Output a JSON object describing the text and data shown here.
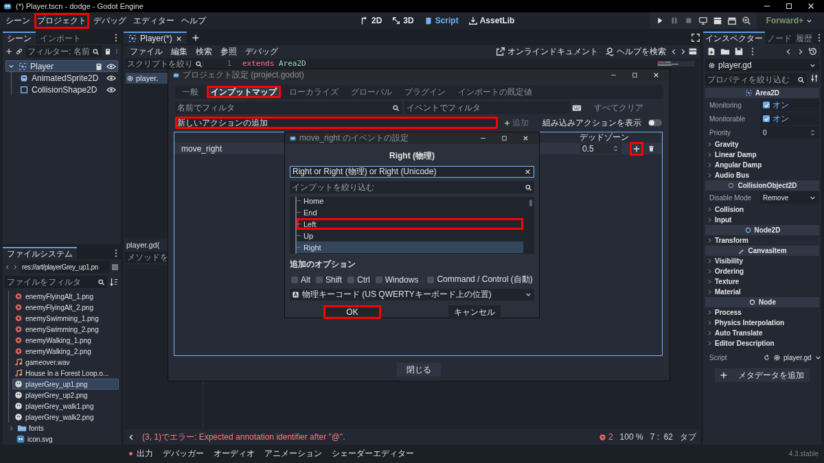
{
  "window": {
    "title": "(*) Player.tscn - dodge - Godot Engine"
  },
  "menu": [
    {
      "label": "シーン",
      "highlighted": false
    },
    {
      "label": "プロジェクト",
      "highlighted": true
    },
    {
      "label": "デバッグ",
      "highlighted": false
    },
    {
      "label": "エディター",
      "highlighted": false
    },
    {
      "label": "ヘルプ",
      "highlighted": false
    }
  ],
  "workspaces": [
    {
      "label": "2D",
      "selected": false
    },
    {
      "label": "3D",
      "selected": false
    },
    {
      "label": "Script",
      "selected": true
    },
    {
      "label": "AssetLib",
      "selected": false
    }
  ],
  "renderer": "Forward+",
  "scene_dock": {
    "tabs": [
      {
        "label": "シーン",
        "selected": true
      },
      {
        "label": "インポート",
        "selected": false
      }
    ],
    "filter": {
      "placeholder": "フィルター: 名前"
    },
    "tree": [
      {
        "name": "Player",
        "kind": "area",
        "selected": true,
        "expanded": true,
        "children": [
          {
            "name": "AnimatedSprite2D",
            "kind": "sprite",
            "selected": false
          },
          {
            "name": "CollisionShape2D",
            "kind": "shape",
            "selected": false
          }
        ]
      }
    ]
  },
  "filesystem": {
    "tab": "ファイルシステム",
    "path": "res://art/playerGrey_up1.pn",
    "filter": {
      "placeholder": "ファイルをフィルタ"
    },
    "folder_contents": [
      {
        "name": "enemyFlyingAlt_1.png",
        "kind": "image",
        "selected": false
      },
      {
        "name": "enemyFlyingAlt_2.png",
        "kind": "image",
        "selected": false
      },
      {
        "name": "enemySwimming_1.png",
        "kind": "image",
        "selected": false
      },
      {
        "name": "enemySwimming_2.png",
        "kind": "image",
        "selected": false
      },
      {
        "name": "enemyWalking_1.png",
        "kind": "image",
        "selected": false
      },
      {
        "name": "enemyWalking_2.png",
        "kind": "image",
        "selected": false
      },
      {
        "name": "gameover.wav",
        "kind": "audio",
        "selected": false
      },
      {
        "name": "House In a Forest Loop.o...",
        "kind": "audio",
        "selected": false
      },
      {
        "name": "playerGrey_up1.png",
        "kind": "player",
        "selected": true
      },
      {
        "name": "playerGrey_up2.png",
        "kind": "player",
        "selected": false
      },
      {
        "name": "playerGrey_walk1.png",
        "kind": "player",
        "selected": false
      },
      {
        "name": "playerGrey_walk2.png",
        "kind": "player",
        "selected": false
      }
    ],
    "root_items": [
      {
        "name": "fonts",
        "kind": "folder",
        "selected": false
      },
      {
        "name": "icon.svg",
        "kind": "svg",
        "selected": false
      }
    ]
  },
  "script_editor": {
    "tabs": [
      {
        "label": "Player(*)",
        "selected": true
      }
    ],
    "menu": [
      "ファイル",
      "編集",
      "検索",
      "参照",
      "デバッグ"
    ],
    "links": [
      {
        "label": "オンラインドキュメント",
        "kind": "docs"
      },
      {
        "label": "ヘルプを検索",
        "kind": "help"
      }
    ],
    "script_filter": {
      "placeholder": "スクリプトを絞り"
    },
    "scripts": [
      {
        "name": "player.",
        "selected": true
      }
    ],
    "current_script": "player.gd(",
    "methods_filter": {
      "placeholder": "メソッドを"
    },
    "code_lines": [
      {
        "number": "1",
        "keyword": "extends",
        "rest": "Area2D"
      }
    ],
    "status": {
      "message": "(3, 1)でエラー: Expected annotation identifier after \"@\".",
      "errors": "2",
      "zoom": "100 %",
      "position": "7 :  62",
      "indent": "タブ"
    }
  },
  "project_settings": {
    "title": "プロジェクト設定 (project.godot)",
    "tabs": [
      {
        "label": "一般",
        "selected": false,
        "highlighted": false
      },
      {
        "label": "インプットマップ",
        "selected": true,
        "highlighted": true
      },
      {
        "label": "ローカライズ",
        "selected": false,
        "highlighted": false
      },
      {
        "label": "グローバル",
        "selected": false,
        "highlighted": false
      },
      {
        "label": "プラグイン",
        "selected": false,
        "highlighted": false
      },
      {
        "label": "インポートの既定値",
        "selected": false,
        "highlighted": false
      }
    ],
    "name_filter": {
      "placeholder": "名前でフィルタ"
    },
    "event_filter": {
      "placeholder": "イベントでフィルタ"
    },
    "clear_all": "すべてクリア",
    "add_action": {
      "placeholder": "新しいアクションの追加",
      "highlighted": true
    },
    "add_button": {
      "label": "追加",
      "disabled": true
    },
    "show_builtin": {
      "label": "組み込みアクションを表示",
      "on": false
    },
    "deadzone_header": "デッドゾーン",
    "actions": [
      {
        "name": "move_right",
        "deadzone": "0.5",
        "add_highlighted": true
      }
    ],
    "close_button": "閉じる"
  },
  "event_dialog": {
    "title": "move_right のイベントの設定",
    "event_name": "Right (物理)",
    "listen_field": {
      "value": "Right or Right (物理) or Right (Unicode)"
    },
    "input_filter": {
      "placeholder": "インプットを絞り込む"
    },
    "keys": [
      {
        "label": "Home",
        "selected": false,
        "highlighted": false
      },
      {
        "label": "End",
        "selected": false,
        "highlighted": false
      },
      {
        "label": "Left",
        "selected": false,
        "highlighted": true
      },
      {
        "label": "Up",
        "selected": false,
        "highlighted": false
      },
      {
        "label": "Right",
        "selected": true,
        "highlighted": false
      }
    ],
    "options_heading": "追加のオプション",
    "modifiers": [
      {
        "label": "Alt",
        "checked": false
      },
      {
        "label": "Shift",
        "checked": false
      },
      {
        "label": "Ctrl",
        "checked": false
      },
      {
        "label": "Windows",
        "checked": false
      }
    ],
    "auto_modifier": {
      "label": "Command / Control (自動)",
      "checked": false
    },
    "keycode_mode": "物理キーコード (US QWERTYキーボード上の位置)",
    "ok": {
      "label": "OK",
      "highlighted": true
    },
    "cancel": "キャンセル"
  },
  "inspector": {
    "tabs": [
      {
        "label": "インスペクター",
        "selected": true
      },
      {
        "label": "ノード",
        "selected": false
      },
      {
        "label": "履歴",
        "selected": false
      }
    ],
    "resource": "player.gd",
    "filter": {
      "placeholder": "プロパティを絞り込む"
    },
    "rows": [
      {
        "kind": "section",
        "label": "Area2D"
      },
      {
        "kind": "check",
        "label": "Monitoring",
        "value": "オン",
        "checked": true
      },
      {
        "kind": "check",
        "label": "Monitorable",
        "value": "オン",
        "checked": true
      },
      {
        "kind": "number",
        "label": "Priority",
        "value": "0"
      },
      {
        "kind": "group",
        "label": "Gravity"
      },
      {
        "kind": "group",
        "label": "Linear Damp"
      },
      {
        "kind": "group",
        "label": "Angular Damp"
      },
      {
        "kind": "group",
        "label": "Audio Bus"
      },
      {
        "kind": "section",
        "label": "CollisionObject2D"
      },
      {
        "kind": "select",
        "label": "Disable Mode",
        "value": "Remove"
      },
      {
        "kind": "group",
        "label": "Collision"
      },
      {
        "kind": "group",
        "label": "Input"
      },
      {
        "kind": "section",
        "label": "Node2D"
      },
      {
        "kind": "group",
        "label": "Transform"
      },
      {
        "kind": "section",
        "label": "CanvasItem"
      },
      {
        "kind": "group",
        "label": "Visibility"
      },
      {
        "kind": "group",
        "label": "Ordering"
      },
      {
        "kind": "group",
        "label": "Texture"
      },
      {
        "kind": "group",
        "label": "Material"
      },
      {
        "kind": "section",
        "label": "Node"
      },
      {
        "kind": "group",
        "label": "Process"
      },
      {
        "kind": "group",
        "label": "Physics Interpolation"
      },
      {
        "kind": "group",
        "label": "Auto Translate"
      },
      {
        "kind": "group",
        "label": "Editor Description"
      },
      {
        "kind": "script",
        "label": "Script",
        "value": "player.gd"
      },
      {
        "kind": "button",
        "label": "メタデータを追加"
      }
    ]
  },
  "bottom_tabs": [
    {
      "label": "出力",
      "kind": "output"
    },
    {
      "label": "デバッガー",
      "kind": "plain"
    },
    {
      "label": "オーディオ",
      "kind": "plain"
    },
    {
      "label": "アニメーション",
      "kind": "plain"
    },
    {
      "label": "シェーダーエディター",
      "kind": "plain"
    }
  ],
  "version": "4.3.stable"
}
